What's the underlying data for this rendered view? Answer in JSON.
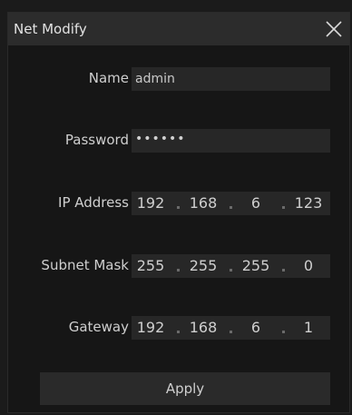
{
  "dialog": {
    "title": "Net Modify",
    "close_icon": "close-icon"
  },
  "form": {
    "name": {
      "label": "Name",
      "value": "admin"
    },
    "password": {
      "label": "Password",
      "value": "••••••"
    },
    "ip_address": {
      "label": "IP Address",
      "octets": [
        "192",
        "168",
        "6",
        "123"
      ]
    },
    "subnet_mask": {
      "label": "Subnet Mask",
      "octets": [
        "255",
        "255",
        "255",
        "0"
      ]
    },
    "gateway": {
      "label": "Gateway",
      "octets": [
        "192",
        "168",
        "6",
        "1"
      ]
    }
  },
  "apply_label": "Apply"
}
